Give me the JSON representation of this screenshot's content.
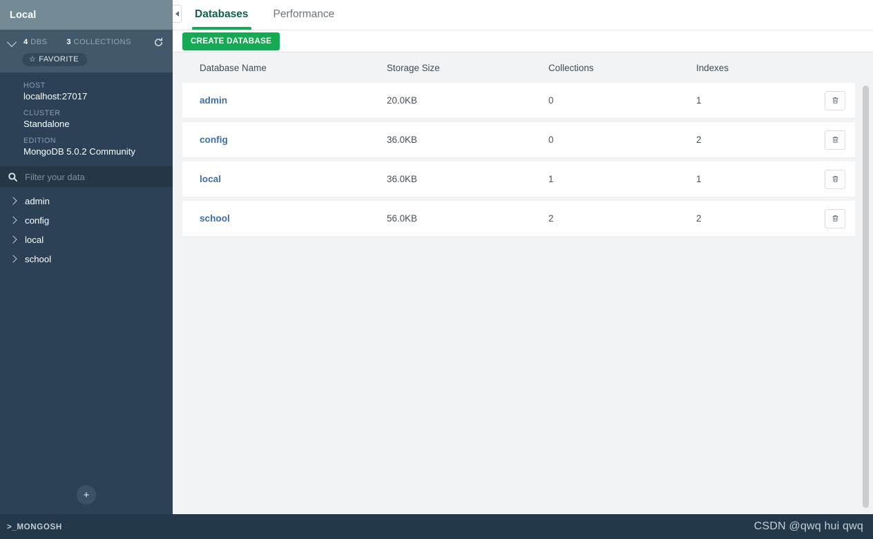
{
  "sidebar": {
    "title": "Local",
    "stats": {
      "dbs_count": "4",
      "dbs_label": "DBS",
      "collections_count": "3",
      "collections_label": "COLLECTIONS",
      "refresh_icon": "refresh-icon",
      "collapse_icon": "chevron-down-icon"
    },
    "favorite": {
      "label": "FAVORITE",
      "star": "☆"
    },
    "info": [
      {
        "label": "HOST",
        "value": "localhost:27017"
      },
      {
        "label": "CLUSTER",
        "value": "Standalone"
      },
      {
        "label": "EDITION",
        "value": "MongoDB 5.0.2 Community"
      }
    ],
    "filter": {
      "placeholder": "Filter your data",
      "value": "",
      "icon": "search-icon"
    },
    "databases": [
      {
        "name": "admin"
      },
      {
        "name": "config"
      },
      {
        "name": "local"
      },
      {
        "name": "school"
      }
    ],
    "add_button_label": "+"
  },
  "main": {
    "collapse_tab_icon": "chevron-left-icon",
    "tabs": [
      {
        "label": "Databases",
        "active": true
      },
      {
        "label": "Performance",
        "active": false
      }
    ],
    "toolbar": {
      "create_database_label": "CREATE DATABASE"
    },
    "table": {
      "columns": [
        "Database Name",
        "Storage Size",
        "Collections",
        "Indexes"
      ],
      "rows": [
        {
          "name": "admin",
          "storage_size": "20.0KB",
          "collections": "0",
          "indexes": "1",
          "delete_icon": "trash-icon"
        },
        {
          "name": "config",
          "storage_size": "36.0KB",
          "collections": "0",
          "indexes": "2",
          "delete_icon": "trash-icon"
        },
        {
          "name": "local",
          "storage_size": "36.0KB",
          "collections": "1",
          "indexes": "1",
          "delete_icon": "trash-icon"
        },
        {
          "name": "school",
          "storage_size": "56.0KB",
          "collections": "2",
          "indexes": "2",
          "delete_icon": "trash-icon"
        }
      ]
    }
  },
  "status_bar": {
    "mongosh_label": ">_MONGOSH",
    "watermark": "CSDN @qwq hui qwq"
  },
  "colors": {
    "brand_green": "#13aa52",
    "active_tab_text": "#116149",
    "sidebar_bg": "#2c4155",
    "sidebar_title_bg": "#748a94",
    "sidebar_stats_bg": "#41596b",
    "status_bar_bg": "#23384a",
    "db_link": "#3e6ea8"
  }
}
